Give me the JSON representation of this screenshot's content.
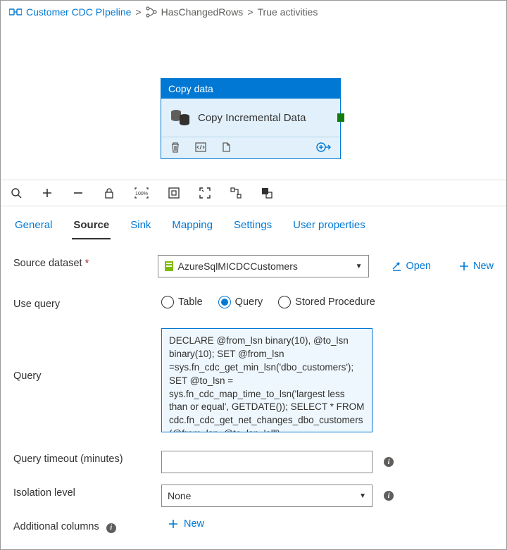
{
  "breadcrumb": {
    "root": "Customer CDC PIpeline",
    "mid": "HasChangedRows",
    "leaf": "True activities"
  },
  "activity": {
    "header": "Copy data",
    "title": "Copy Incremental Data"
  },
  "tabs": {
    "general": "General",
    "source": "Source",
    "sink": "Sink",
    "mapping": "Mapping",
    "settings": "Settings",
    "userprops": "User properties"
  },
  "form": {
    "source_dataset_label": "Source dataset",
    "source_dataset_value": "AzureSqlMICDCCustomers",
    "open": "Open",
    "new": "New",
    "use_query_label": "Use query",
    "radio_table": "Table",
    "radio_query": "Query",
    "radio_sp": "Stored Procedure",
    "query_label": "Query",
    "query_value": "DECLARE @from_lsn binary(10), @to_lsn binary(10); SET @from_lsn =sys.fn_cdc_get_min_lsn('dbo_customers'); SET @to_lsn = sys.fn_cdc_map_time_to_lsn('largest less than or equal', GETDATE()); SELECT * FROM cdc.fn_cdc_get_net_changes_dbo_customers(@from_lsn, @to_lsn, 'all')",
    "query_timeout_label": "Query timeout (minutes)",
    "query_timeout_value": "",
    "isolation_label": "Isolation level",
    "isolation_value": "None",
    "additional_columns_label": "Additional columns",
    "add_new": "New"
  }
}
